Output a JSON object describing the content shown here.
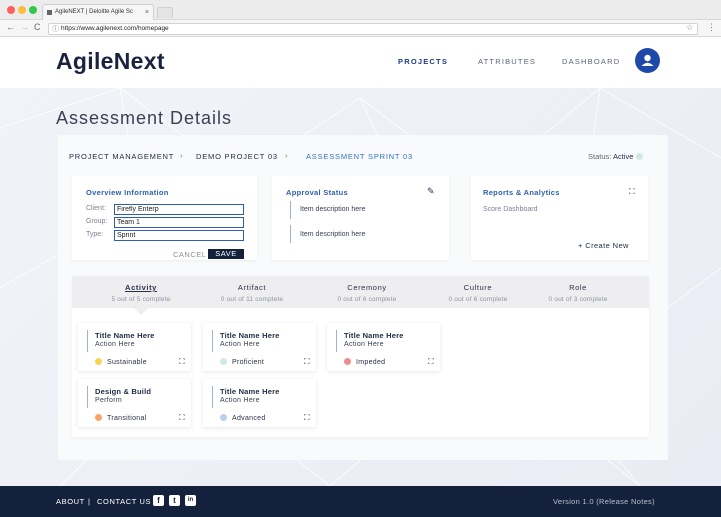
{
  "browser": {
    "tab_title": "AgileNEXT | Deloitte Agile Sc",
    "tab_close": "×",
    "url": "https://www.agilenext.com/homepage",
    "back": "←",
    "forward": "→",
    "reload": "C",
    "info": "ⓘ",
    "star": "☆",
    "menu": "⋮"
  },
  "header": {
    "logo": "AgileNext",
    "nav": [
      "PROJECTS",
      "ATTRIBUTES",
      "DASHBOARD"
    ],
    "active_nav": "PROJECTS"
  },
  "page": {
    "title": "Assessment Details",
    "breadcrumb": [
      "PROJECT MANAGEMENT",
      "DEMO PROJECT 03",
      "ASSESSMENT SPRINT 03"
    ],
    "breadcrumb_sep": "›",
    "status_label": "Status:",
    "status_value": "Active",
    "status_color": "#cfe9e4"
  },
  "overview": {
    "title": "Overview Information",
    "client_label": "Client:",
    "client_value": "Firefly Enterp",
    "group_label": "Group:",
    "group_value": "Team 1",
    "type_label": "Type:",
    "type_value": "Sprint",
    "cancel": "CANCEL",
    "save": "SAVE"
  },
  "approval": {
    "title": "Approval Status",
    "pencil": "✎",
    "items": [
      "Item description here",
      "Item description here"
    ]
  },
  "reports": {
    "title": "Reports & Analytics",
    "link": "Score Dashboard",
    "create": "+  Create New"
  },
  "expand_icon": "⛶",
  "tabs": [
    {
      "name": "Activity",
      "sub": "5 out of 5 complete"
    },
    {
      "name": "Artifact",
      "sub": "0 out of 11 complete"
    },
    {
      "name": "Ceremony",
      "sub": "0 out of 6 complete"
    },
    {
      "name": "Culture",
      "sub": "0 out of 6 complete"
    },
    {
      "name": "Role",
      "sub": "0 out of 3 complete"
    }
  ],
  "tiles": [
    {
      "title": "Title Name Here",
      "sub": "Action Here",
      "level": "Sustainable",
      "color": "#f6d556"
    },
    {
      "title": "Title Name Here",
      "sub": "Action Here",
      "level": "Proficient",
      "color": "#cfe9e4"
    },
    {
      "title": "Title Name Here",
      "sub": "Action Here",
      "level": "Impeded",
      "color": "#ef8a8e"
    },
    {
      "title": "Design & Build",
      "sub": "Perform",
      "level": "Transitional",
      "color": "#f5a66d"
    },
    {
      "title": "Title Name Here",
      "sub": "Action Here",
      "level": "Advanced",
      "color": "#b9cfee"
    }
  ],
  "footer": {
    "about": "ABOUT",
    "divider": "|",
    "contact": "CONTACT US",
    "social": [
      "f",
      "t",
      "in"
    ],
    "version": "Version 1.0  (Release Notes)"
  }
}
